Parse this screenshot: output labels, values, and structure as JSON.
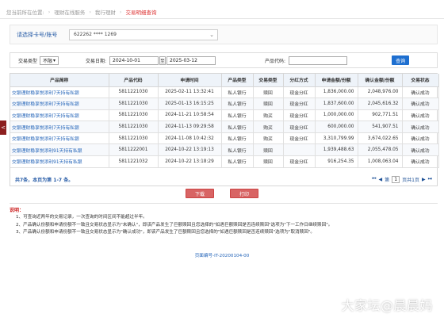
{
  "breadcrumb": {
    "prefix": "您当前所在位置:",
    "items": [
      "理财在线服务",
      "我行理财",
      "交易明细查询"
    ]
  },
  "account": {
    "label": "请选择卡号/账号",
    "value": "622262 **** 1269"
  },
  "filter": {
    "type_label": "交易类型",
    "type_value": "不限",
    "date_label": "交易日期:",
    "date_from": "2024-10-01",
    "date_to_sep": "至",
    "date_to": "2025-03-12",
    "code_label": "产品代码:",
    "code_value": "",
    "query_button": "查询"
  },
  "table": {
    "headers": [
      "产品简称",
      "产品代码",
      "申请时间",
      "产品类型",
      "交易类型",
      "分红方式",
      "申请金额/份额",
      "确认金额/份额",
      "交易状态"
    ],
    "rows": [
      [
        "交银理财稳享悦添利7天持有私银",
        "5811221030",
        "2025-02-11 13:32:41",
        "私人银行",
        "赎回",
        "现金分红",
        "1,836,000.00",
        "2,048,976.00",
        "确认成功"
      ],
      [
        "交银理财稳享悦添利7天持有私银",
        "5811221030",
        "2025-01-13 16:15:25",
        "私人银行",
        "赎回",
        "现金分红",
        "1,837,600.00",
        "2,045,616.32",
        "确认成功"
      ],
      [
        "交银理财稳享悦添利7天持有私银",
        "5811221030",
        "2024-11-21 10:58:54",
        "私人银行",
        "购买",
        "现金分红",
        "1,000,000.00",
        "902,771.51",
        "确认成功"
      ],
      [
        "交银理财稳享悦添利7天持有私银",
        "5811221030",
        "2024-11-13 09:29:58",
        "私人银行",
        "购买",
        "现金分红",
        "600,000.00",
        "541,907.51",
        "确认成功"
      ],
      [
        "交银理财稳享悦添利7天持有私银",
        "5811221030",
        "2024-11-08 10:42:32",
        "私人银行",
        "购买",
        "现金分红",
        "3,310,799.99",
        "3,674,022.65",
        "确认成功"
      ],
      [
        "交银理财稳享悦添利91天持有私银",
        "5811222001",
        "2024-10-22 13:19:13",
        "私人银行",
        "赎回",
        "",
        "1,939,488.63",
        "2,055,478.05",
        "确认成功"
      ],
      [
        "交银理财稳享悦添利91天持有私银",
        "5811221032",
        "2024-10-22 13:18:29",
        "私人银行",
        "赎回",
        "现金分红",
        "916,254.35",
        "1,008,063.04",
        "确认成功"
      ]
    ]
  },
  "pager": {
    "summary": "共7条，本页为第 1-7 条。",
    "page": "1",
    "go_label": "页共1页"
  },
  "buttons": {
    "download": "下载",
    "print": "打印"
  },
  "notes": {
    "heading": "说明：",
    "items": [
      "1、可查询近两年的交易记录，一次查询的时间区间不能超过半年。",
      "2、产品确认份额和申请份额不一致且交易状态显示为\"未确认\"，即该产品发生了巨额赎回且您选择的\"如遇巨额赎回是否连续赎回\"选项为\"下一工作日继续赎回\"。",
      "3、产品确认份额和申请份额不一致且交易状态显示为\"确认成功\"，即该产品发生了巨额赎回且您选择的\"如遇巨额赎回是否连续赎回\"选项为\"取消赎回\"。"
    ]
  },
  "page_no": "页面编号-IT-20200104-00",
  "watermark": "大家坛@晨晨妈",
  "side_tab": "<"
}
